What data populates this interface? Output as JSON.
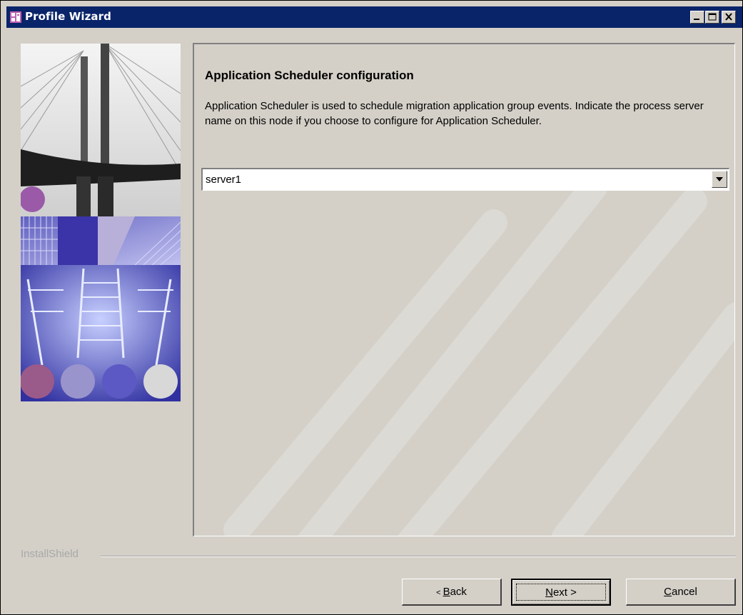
{
  "window": {
    "title": "Profile Wizard",
    "title_bar_color": "#0a246a"
  },
  "page": {
    "heading": "Application Scheduler configuration",
    "description": "Application Scheduler is used to schedule migration application group events. Indicate the process server name on this node if you choose to configure for Application Scheduler."
  },
  "server_select": {
    "selected": "server1"
  },
  "branding": {
    "label": "InstallShield"
  },
  "buttons": {
    "back": {
      "prefix": "< ",
      "mnemonic": "B",
      "rest": "ack"
    },
    "next": {
      "mnemonic": "N",
      "rest": "ext >"
    },
    "cancel": {
      "mnemonic": "C",
      "rest": "ancel"
    }
  },
  "icons": {
    "window_icon": "wizard-app-icon",
    "minimize": "minimize-icon",
    "maximize": "maximize-icon",
    "close": "close-icon",
    "dropdown": "chevron-down-icon"
  }
}
